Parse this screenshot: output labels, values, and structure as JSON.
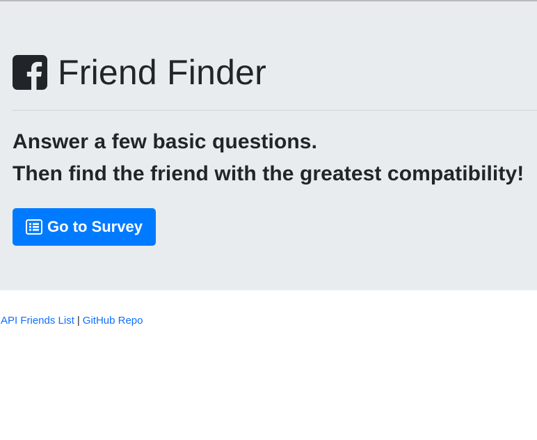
{
  "header": {
    "logo_icon": "facebook-square-icon",
    "title": "Friend Finder"
  },
  "lead": {
    "line1": "Answer a few basic questions.",
    "line2": "Then find the friend with the greatest compatibility!"
  },
  "cta": {
    "icon": "list-alt-icon",
    "label": "Go to Survey"
  },
  "footer": {
    "links": [
      {
        "label": "API Friends List"
      },
      {
        "label": "GitHub Repo"
      }
    ],
    "separator": "|"
  },
  "colors": {
    "jumbotron_bg": "#e9ecef",
    "primary": "#007bff",
    "link": "#0d6efd",
    "text": "#212529"
  }
}
